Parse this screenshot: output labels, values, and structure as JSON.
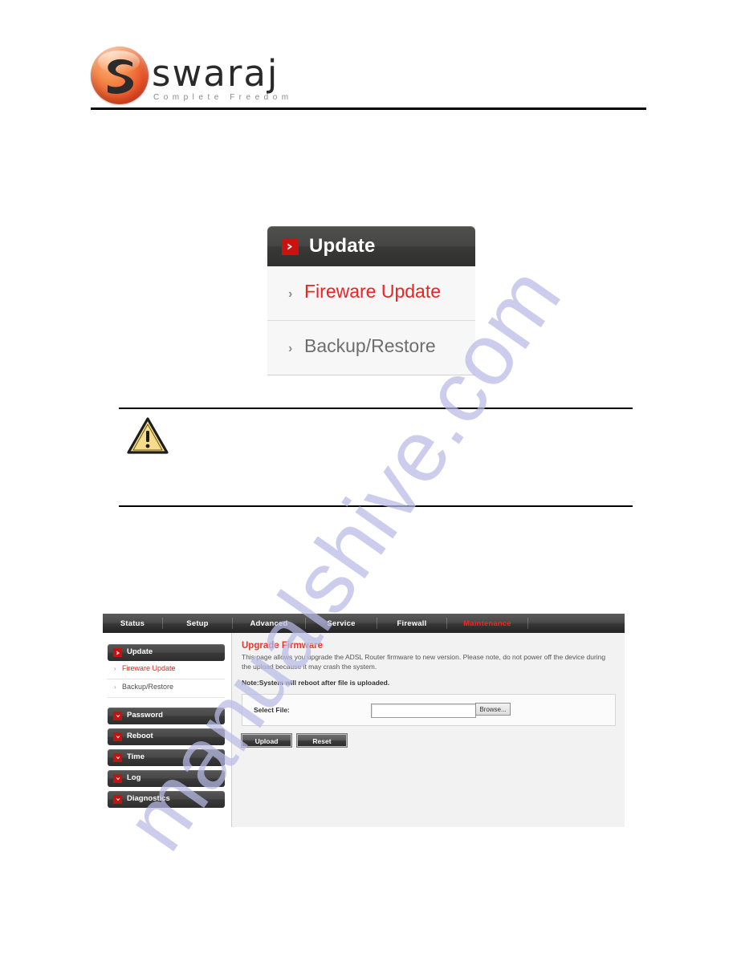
{
  "document": {
    "logo": {
      "wordmark": "swaraj",
      "tagline": "Complete Freedom",
      "mark_icon": "swaraj-s-mark"
    }
  },
  "menu_screenshot": {
    "header": {
      "label": "Update",
      "icon": "red-arrow-badge-icon"
    },
    "items": [
      {
        "label": "Fireware Update",
        "state": "active",
        "icon": "chevron-right-icon"
      },
      {
        "label": "Backup/Restore",
        "state": "normal",
        "icon": "chevron-right-icon"
      }
    ]
  },
  "note_box": {
    "icon": "warning-triangle-icon",
    "text": ""
  },
  "router_ui": {
    "nav": {
      "tabs": [
        {
          "label": "Status",
          "active": false
        },
        {
          "label": "Setup",
          "active": false
        },
        {
          "label": "Advanced",
          "active": false
        },
        {
          "label": "Service",
          "active": false
        },
        {
          "label": "Firewall",
          "active": false
        },
        {
          "label": "Maintenance",
          "active": true
        }
      ]
    },
    "sidebar": {
      "group_header": {
        "label": "Update",
        "icon": "red-arrow-badge-icon"
      },
      "sub_items": [
        {
          "label": "Fireware Update",
          "active": true,
          "icon": "chevron-right-icon"
        },
        {
          "label": "Backup/Restore",
          "active": false,
          "icon": "chevron-right-icon"
        }
      ],
      "items": [
        {
          "label": "Password",
          "icon": "red-chevron-down-badge-icon"
        },
        {
          "label": "Reboot",
          "icon": "red-chevron-down-badge-icon"
        },
        {
          "label": "Time",
          "icon": "red-chevron-down-badge-icon"
        },
        {
          "label": "Log",
          "icon": "red-chevron-down-badge-icon"
        },
        {
          "label": "Diagnostics",
          "icon": "red-chevron-down-badge-icon"
        }
      ]
    },
    "main": {
      "title": "Upgrade Firmware",
      "description": "This page allows you upgrade the ADSL Router firmware to new version. Please note, do not power off the device during the upload because it may crash the system.",
      "note": "Note:System will reboot after file is uploaded.",
      "form": {
        "file_label": "Select File:",
        "file_value": "",
        "file_placeholder": "",
        "browse_label": "Browse..."
      },
      "buttons": {
        "upload": "Upload",
        "reset": "Reset"
      }
    }
  },
  "watermark": {
    "text": "manualshive.com",
    "color": "#b9bbe6"
  },
  "colors": {
    "accent_red": "#e02020",
    "title_red": "#e23a28",
    "dark_bar": "#3a3a3a"
  }
}
